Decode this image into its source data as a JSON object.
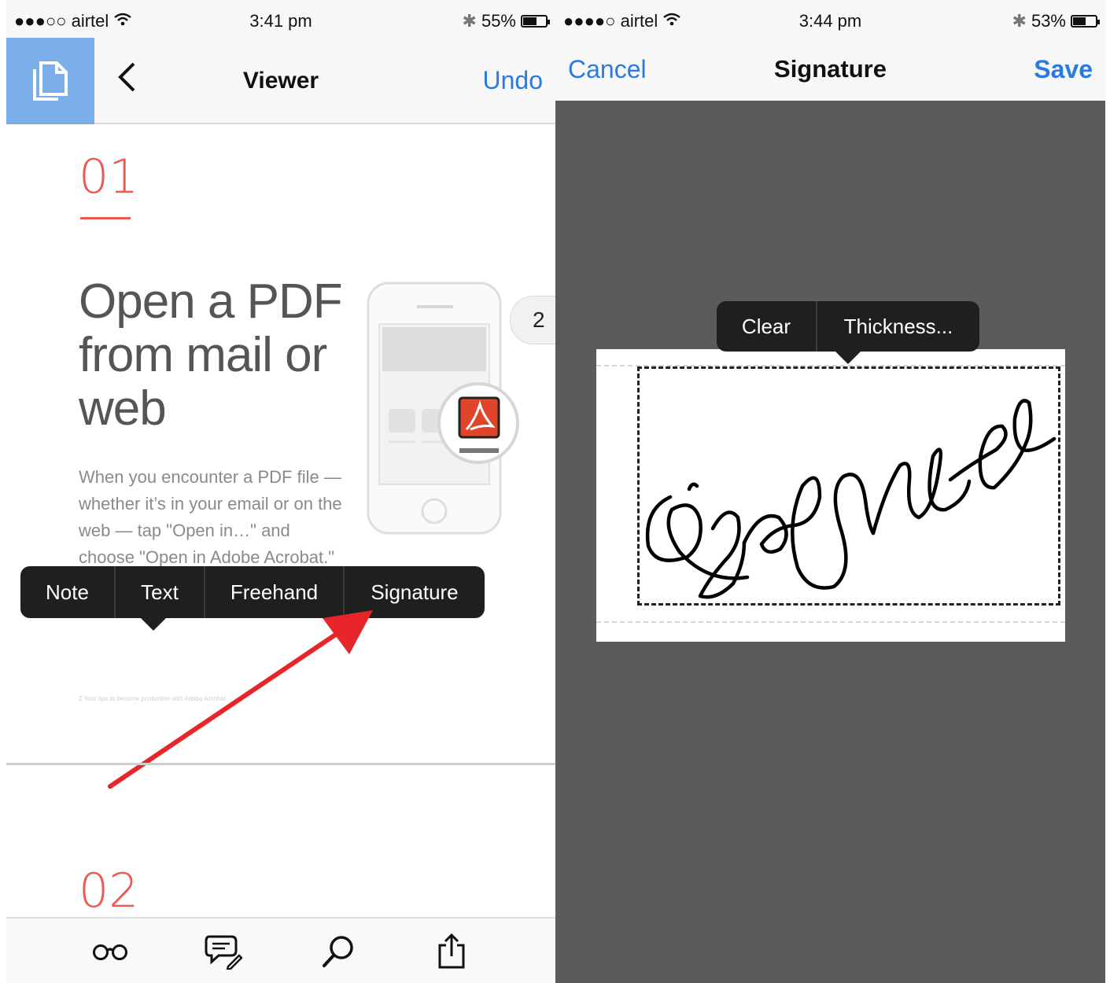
{
  "left_screen": {
    "status": {
      "carrier": "airtel",
      "time": "3:41 pm",
      "battery": "55%",
      "battery_level": 0.55
    },
    "nav": {
      "title": "Viewer",
      "undo_label": "Undo"
    },
    "page1": {
      "number": "01",
      "heading": "Open a PDF from mail or web",
      "body": "When you encounter a PDF file —whether it’s in your email or on the web — tap \"Open in…\" and choose \"Open in Adobe Acrobat.\"",
      "footnote": "2  Your tips to become productive with Adobe Acrobat"
    },
    "page_indicator": "2",
    "popup_menu": [
      "Note",
      "Text",
      "Freehand",
      "Signature"
    ],
    "page2": {
      "number": "02"
    },
    "toolbar": [
      "reading-mode-icon",
      "comment-icon",
      "search-icon",
      "share-icon"
    ],
    "colors": {
      "accent": "#2a7ae2",
      "step_red": "#ec5a4f",
      "arrow": "#e8262a",
      "tile_blue": "#7aaee8"
    }
  },
  "right_screen": {
    "status": {
      "carrier": "airtel",
      "time": "3:44 pm",
      "battery": "53%",
      "battery_level": 0.53
    },
    "nav": {
      "cancel_label": "Cancel",
      "title": "Signature",
      "save_label": "Save"
    },
    "popup_menu": [
      "Clear",
      "Thickness..."
    ],
    "colors": {
      "canvas_bg": "#5b5b5b"
    }
  }
}
